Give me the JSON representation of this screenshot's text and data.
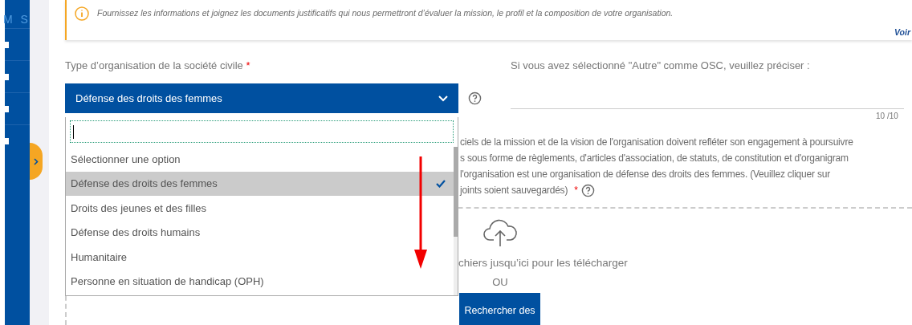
{
  "sidebar": {
    "brand": "M S"
  },
  "notice": {
    "text": "Fournissez les informations et joignez les documents justificatifs qui nous permettront d’évaluer la mission, le profil et la composition de votre organisation.",
    "link": "Voir"
  },
  "org_type": {
    "label": "Type d’organisation de la société civile",
    "required_mark": "*",
    "value": "Défense des droits des femmes",
    "dropdown": {
      "options": [
        {
          "label": "Sélectionner une option",
          "selected": false
        },
        {
          "label": "Défense des droits des femmes",
          "selected": true
        },
        {
          "label": "Droits des jeunes et des filles",
          "selected": false
        },
        {
          "label": "Défense des droits humains",
          "selected": false
        },
        {
          "label": "Humanitaire",
          "selected": false
        },
        {
          "label": "Personne en situation de handicap (OPH)",
          "selected": false
        }
      ]
    }
  },
  "other": {
    "label": "Si vous avez sélectionné \"Autre\" comme OSC, veuillez préciser :",
    "counter": "10 /10"
  },
  "documents": {
    "description_lines": [
      "ciels de la mission et de la vision de l'organisation doivent refléter son engagement à poursuivre",
      "s sous forme de règlements, d'articles d'association, de statuts, de constitution et d'organigram",
      "l'organisation est une organisation de défense des droits des femmes. (Veuillez cliquer sur",
      "joints soient sauvegardés)"
    ],
    "required_mark": "*",
    "drop_text": "chiers jusqu’ici pour les télécharger",
    "separator": "OU",
    "button": "Rechercher des"
  }
}
